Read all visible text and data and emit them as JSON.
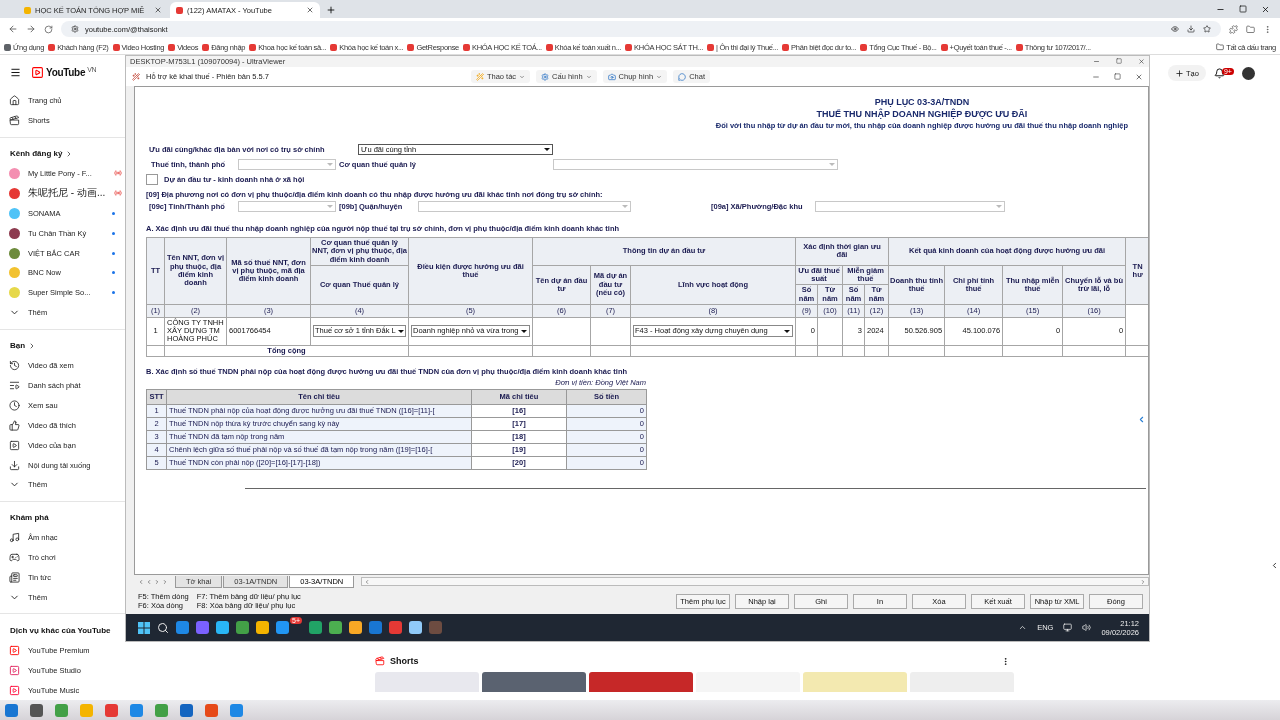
{
  "browser": {
    "tabs": [
      {
        "title": "HỌC KẾ TOÁN TỔNG HỢP MIỄ",
        "selected": false
      },
      {
        "title": "(122) AMATAX - YouTube",
        "selected": true
      }
    ],
    "address": "youtube.com/@thaisonkt",
    "bookmarks": [
      "Ứng dụng",
      "Khách hàng (F2)",
      "Video Hosting",
      "Videos",
      "Đăng nhập",
      "Khoa học kế toán sả...",
      "Khóa học kế toán x...",
      "GetResponse",
      "KHÓA HỌC KẾ TOÁ...",
      "Khóa kế toán xuất n...",
      "KHÓA HỌC SÁT TH...",
      "| Ôn thi đại lý Thuế...",
      "Phân biệt đọc dư to...",
      "Tổng Cục Thuế - Bộ...",
      "+Quyết toán thuế -...",
      "Thông tư 107/2017/..."
    ],
    "all_bookmarks": "Tất cả dấu trang"
  },
  "youtube": {
    "logo": "YouTube",
    "region": "VN",
    "create": "Tạo",
    "notifications": "9+",
    "shorts_title": "Shorts",
    "sections": [
      {
        "items": [
          {
            "kind": "link",
            "label": "Trang chủ"
          },
          {
            "kind": "link",
            "label": "Shorts"
          }
        ]
      },
      {
        "title": "Kênh đăng ký",
        "items": [
          {
            "kind": "channel",
            "label": "My Little Pony - F...",
            "color": "#f48fb1",
            "live": true
          },
          {
            "kind": "channel",
            "label": "朱呢托尼 - 动画...",
            "color": "#e53935",
            "live": true
          },
          {
            "kind": "channel",
            "label": "SONAMA",
            "color": "#4fc3f7",
            "live": false
          },
          {
            "kind": "channel",
            "label": "Tu Chân Thần Ký",
            "color": "#8d3b4f",
            "live": false
          },
          {
            "kind": "channel",
            "label": "VIỆT BẮC CAR",
            "color": "#6d8b3c",
            "live": false
          },
          {
            "kind": "channel",
            "label": "BNC Now",
            "color": "#f2c230",
            "live": false
          },
          {
            "kind": "channel",
            "label": "Super Simple So...",
            "color": "#e6d84a",
            "live": false
          },
          {
            "kind": "more",
            "label": "Thêm"
          }
        ]
      },
      {
        "title": "Bạn",
        "items": [
          {
            "kind": "link",
            "label": "Video đã xem"
          },
          {
            "kind": "link",
            "label": "Danh sách phát"
          },
          {
            "kind": "link",
            "label": "Xem sau"
          },
          {
            "kind": "link",
            "label": "Video đã thích"
          },
          {
            "kind": "link",
            "label": "Video của bạn"
          },
          {
            "kind": "link",
            "label": "Nội dung tải xuống"
          },
          {
            "kind": "more",
            "label": "Thêm"
          }
        ]
      },
      {
        "title": "Khám phá",
        "items": [
          {
            "kind": "link",
            "label": "Âm nhạc"
          },
          {
            "kind": "link",
            "label": "Trò chơi"
          },
          {
            "kind": "link",
            "label": "Tin tức"
          },
          {
            "kind": "more",
            "label": "Thêm"
          }
        ]
      },
      {
        "title": "Dịch vụ khác của YouTube",
        "items": [
          {
            "kind": "service",
            "label": "YouTube Premium"
          },
          {
            "kind": "service",
            "label": "YouTube Studio"
          },
          {
            "kind": "service",
            "label": "YouTube Music"
          }
        ]
      }
    ]
  },
  "remote": {
    "title": "DESKTOP-M753L1 (109070094) - UltraViewer",
    "app_title": "Hỗ trợ kê khai thuế - Phiên bản 5.5.7",
    "toolbar": [
      "Thao tác",
      "Cấu hình",
      "Chụp hình",
      "Chat"
    ],
    "form": {
      "heading": "PHỤ LỤC 03-3A/TNDN",
      "title": "THUẾ THU NHẬP DOANH NGHIỆP ĐƯỢC ƯU ĐÃI",
      "note": "Đối với thu nhập từ dự án đầu tư mới, thu nhập của doanh nghiệp được hưởng ưu đãi thuế thu nhập doanh nghiệp",
      "location_scope": {
        "label": "Ưu đãi cùng/khác địa bàn với nơi  có trụ sở chính",
        "value": "Ưu đãi cùng tỉnh",
        "disabled": false
      },
      "province": {
        "label": "Thuế tỉnh, thành phố",
        "disabled": true
      },
      "tax_office": {
        "label": "Cơ quan thuế quản lý",
        "disabled": true
      },
      "social_housing": {
        "label": "Dự án đầu tư - kinh doanh nhà ở xã hội",
        "checked": false
      },
      "section_09": "[09] Địa phương nơi có đơn vị phụ thuộc/địa điểm kinh doanh có thu nhập được hưởng ưu đãi khác tỉnh nơi đóng trụ sở chính:",
      "fields_09": [
        {
          "label": "[09c] Tỉnh/Thành phố",
          "disabled": true
        },
        {
          "label": "[09b]  Quận/huyện",
          "disabled": true
        },
        {
          "label": "[09a] Xã/Phường/Đặc khu",
          "disabled": true
        }
      ],
      "section_a": {
        "title": "A. Xác định ưu đãi thuế thu nhập doanh nghiệp của người nộp thuế tại trụ sở chính, đơn vị phụ thuộc/địa điểm kinh doanh khác tỉnh",
        "header_rows": [
          [
            "TT",
            "Tên NNT, đơn vị phụ thuộc, địa điểm kinh doanh",
            "Mã số thuế NNT, đơn vị phụ thuộc, mã địa điểm kinh doanh",
            "Cơ quan thuế quản lý NNT, đơn vị phụ thuộc, địa điểm kinh doanh",
            "Điều kiện được hưởng ưu đãi thuế",
            "Thông tin dự án đầu tư",
            "Xác định thời gian ưu đãi",
            "Kết quả kinh doanh của hoạt động được hưởng ưu đãi",
            "TN hư"
          ],
          [
            "Cơ quan Thuế quản lý",
            "Tên dự án đầu tư",
            "Mã dự án đầu tư (nếu có)",
            "Lĩnh vực hoạt động",
            "Ưu đãi thuế suất",
            "Miễn giảm thuế",
            "Doanh thu tính thuế",
            "Chi phí tính thuế",
            "Thu nhập miễn thuế",
            "Chuyển lỗ và bù trừ lãi, lỗ"
          ],
          [
            "Số năm",
            "Từ năm",
            "Số năm",
            "Từ năm"
          ]
        ],
        "column_numbers": [
          "(1)",
          "(2)",
          "(3)",
          "(4)",
          "(5)",
          "(6)",
          "(7)",
          "(8)",
          "(9)",
          "(10)",
          "(11)",
          "(12)",
          "(13)",
          "(14)",
          "(15)",
          "(16)"
        ],
        "row": {
          "tt": "1",
          "name": "CÔNG TY TNHH XÂY DỰNG TM HOÀNG PHÚC",
          "tax_code": "6001766454",
          "tax_office": "Thuế cơ sở 1 tỉnh Đắk L",
          "condition": "Doanh nghiệp nhỏ và vừa trong",
          "sector": "F43 - Hoạt động xây dựng chuyên dụng",
          "incentive_years": "0",
          "exemption_years": "3",
          "from_year": "2024",
          "revenue": "50.526.905",
          "cost": "45.100.076",
          "exempt_income": "0",
          "loss_transfer": "0"
        },
        "total_label": "Tổng cộng"
      },
      "section_b": {
        "title": "B. Xác định số thuế TNDN phải nộp của hoạt động được hưởng ưu đãi thuế TNDN của đơn vị phụ thuộc/địa điểm kinh doanh khác tỉnh",
        "unit": "Đơn vị tiền: Đồng Việt Nam",
        "columns": [
          "STT",
          "Tên chỉ tiêu",
          "Mã chỉ tiêu",
          "Số tiền"
        ],
        "rows": [
          {
            "no": "1",
            "name": "Thuế TNDN phải nộp của hoạt động được hưởng ưu đãi thuế TNDN ([16]=[11]-[",
            "code": "[16]",
            "amount": "0"
          },
          {
            "no": "2",
            "name": "Thuế TNDN nộp thừa kỳ trước chuyển sang kỳ này",
            "code": "[17]",
            "amount": "0"
          },
          {
            "no": "3",
            "name": "Thuế TNDN đã tạm nộp trong năm",
            "code": "[18]",
            "amount": "0"
          },
          {
            "no": "4",
            "name": "Chênh lệch giữa số thuế phải nộp và số thuế đã tạm nộp trong năm ([19]=[16]-[",
            "code": "[19]",
            "amount": "0"
          },
          {
            "no": "5",
            "name": "Thuế TNDN còn phải nộp ([20]=[16]-[17]-[18])",
            "code": "[20]",
            "amount": "0"
          }
        ]
      }
    },
    "sheet_tabs": [
      {
        "label": "Tờ khai",
        "selected": false
      },
      {
        "label": "03-1A/TNDN",
        "selected": false
      },
      {
        "label": "03-3A/TNDN",
        "selected": true
      }
    ],
    "hints": [
      "F5: Thêm dòng",
      "F6: Xóa dòng",
      "F7: Thêm bảng dữ liệu/ phụ lục",
      "F8: Xóa bảng dữ liệu/ phụ lục"
    ],
    "buttons": [
      "Thêm phụ lục",
      "Nhập lại",
      "Ghi",
      "In",
      "Xóa",
      "Kết xuất",
      "Nhập từ XML",
      "Đóng"
    ],
    "taskbar": {
      "badge": "5+",
      "language": "ENG",
      "time": "21:12",
      "date": "09/02/2026"
    }
  }
}
